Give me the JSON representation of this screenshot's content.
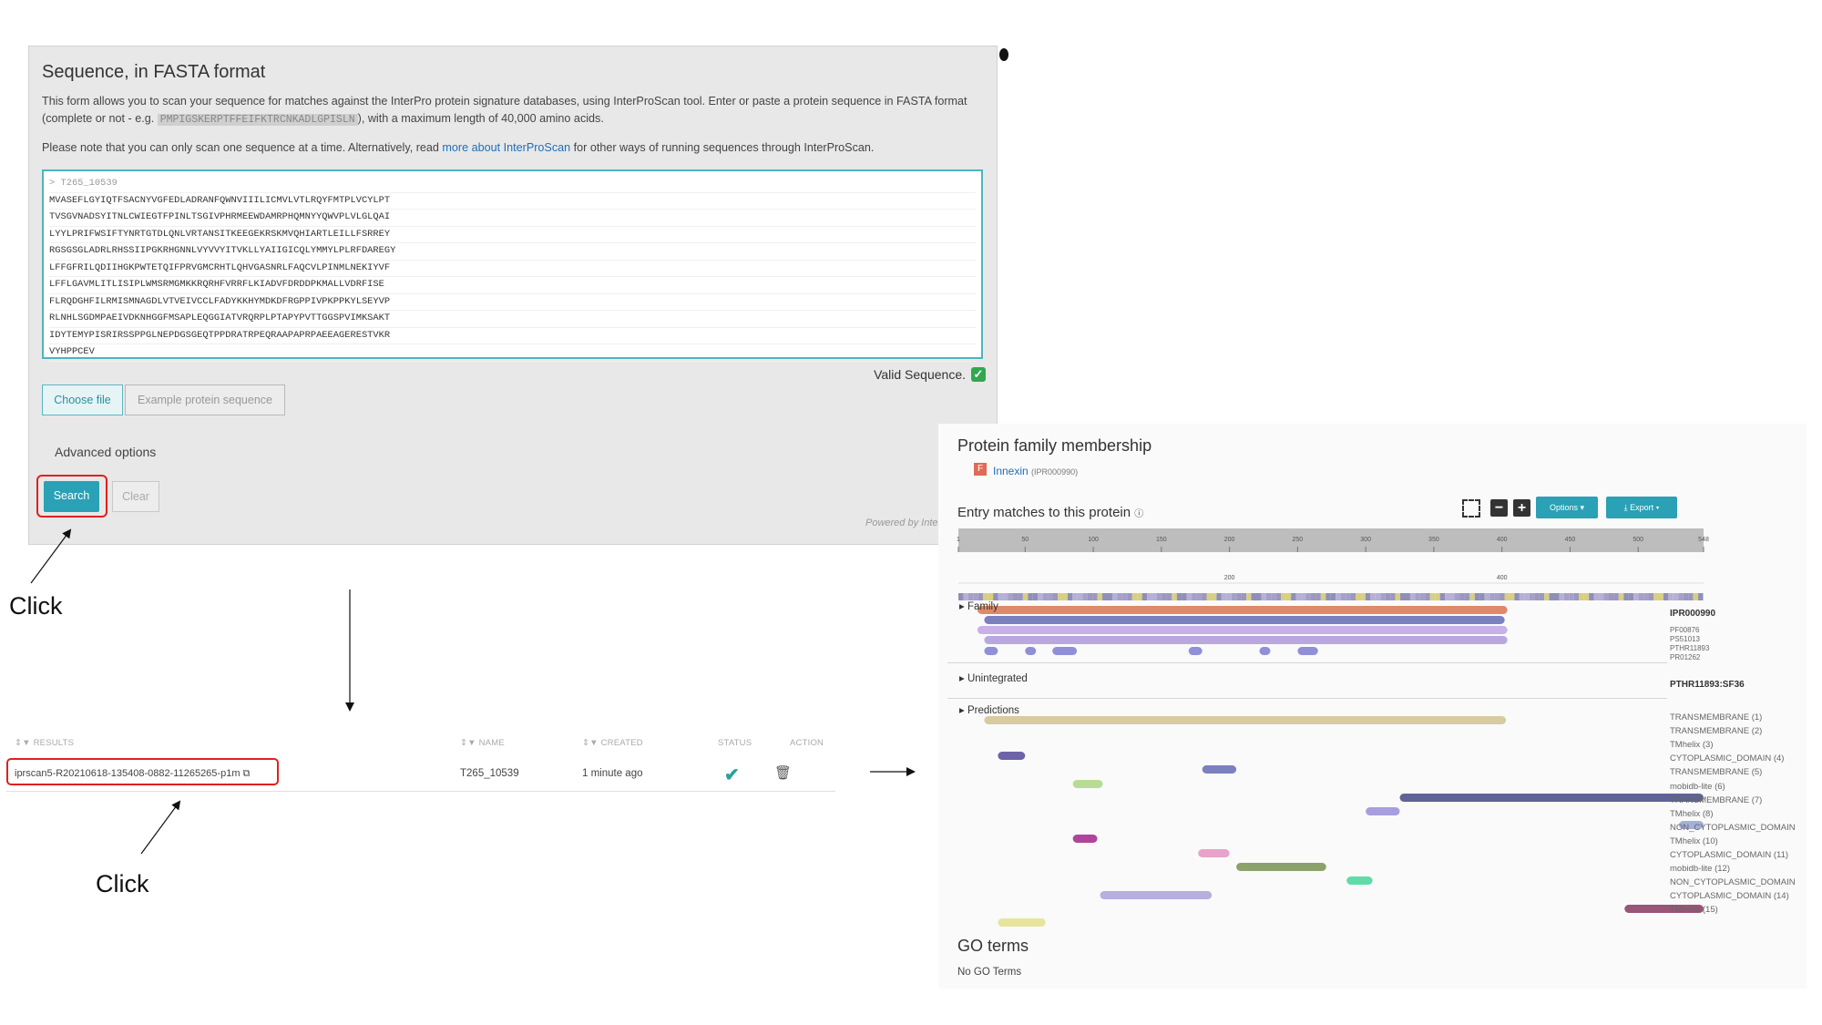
{
  "form": {
    "title": "Sequence, in FASTA format",
    "description_1": "This form allows you to scan your sequence for matches against the InterPro protein signature databases, using InterProScan tool. Enter or paste a protein sequence in FASTA format (complete or not - e.g. ",
    "example_snippet": "PMPIGSKERPTFFEIFKTRCNKADLGPISLN",
    "description_2": "), with a maximum length of 40,000 amino acids.",
    "note_1": "Please note that you can only scan one sequence at a time. Alternatively, read ",
    "note_link": "more about InterProScan",
    "note_2": " for other ways of running sequences through InterProScan.",
    "sequence_lines": [
      "> T265_10539",
      "MVASEFLGYIQTFSACNYVGFEDLADRANFQWNVIIILICMVLVTLRQYFMTPLVCYLPT",
      "TVSGVNADSYITNLCWIEGTFPINLTSGIVPHRMEEWDAMRPHQMNYYQWVPLVLGLQAI",
      "LYYLPRIFWSIFTYNRTGTDLQNLVRTANSITKEEGEKRSKMVQHIARTLEILLFSRREY",
      "RGSGSGLADRLRHSSIIPGKRHGNNLVYVVYITVKLLYAIIGICQLYMMYLPLRFDAREGY",
      "LFFGFRILQDIIHGKPWTETQIFPRVGMCRHTLQHVGASNRLFAQCVLPINMLNEKIYVF",
      "LFFLGAVMLITLISIPLWMSRMGMKKRQRHFVRRFLKIADVFDRDDPKMALLVDRFISE",
      "FLRQDGHFILRMISMNAGDLVTVEIVCCLFADYKKHYMDKDFRGPPIVPKPPKYLSEYVP",
      "RLNHLSGDMPAEIVDKNHGGFMSAPLEQGGIATVRQRPLPTAPYPVTTGGSPVIMKSAKT",
      "IDYTEMYPISRIRSSPPGLNEPDGSGEQTPPDRATRPEQRAAPAPRPAEEAGERESTVKR",
      "VYHPPCEV"
    ],
    "valid_label": "Valid Sequence.",
    "valid_icon": "check-mark-icon",
    "choose_file": "Choose file",
    "example_button": "Example protein sequence",
    "advanced": "Advanced options",
    "search": "Search",
    "clear": "Clear",
    "powered": "Powered by Inter"
  },
  "annotations": {
    "click_1": "Click",
    "click_2": "Click"
  },
  "results_table": {
    "headers": {
      "results": "RESULTS",
      "name": "NAME",
      "created": "CREATED",
      "status": "STATUS",
      "action": "ACTION"
    },
    "row": {
      "id": "iprscan5-R20210618-135408-0882-11265265-p1m",
      "name": "T265_10539",
      "created": "1 minute ago",
      "status_icon": "check-icon",
      "action_icon": "trash-icon"
    }
  },
  "protein_result": {
    "family_title": "Protein family membership",
    "family_badge": "F",
    "family_name": "Innexin",
    "family_acc": "(IPR000990)",
    "entry_title": "Entry matches to this protein",
    "options": "Options",
    "export": "Export",
    "ruler_ticks": [
      "1",
      "50",
      "100",
      "150",
      "200",
      "250",
      "300",
      "350",
      "400",
      "450",
      "500",
      "548"
    ],
    "minimap_ticks": [
      "200",
      "400"
    ],
    "categories": {
      "family": "Family",
      "unintegrated": "Unintegrated",
      "predictions": "Predictions"
    },
    "family_tracks": [
      "IPR000990",
      "PF00876",
      "PS51013",
      "PTHR11893",
      "PR01262"
    ],
    "unintegrated_tracks": [
      "PTHR11893:SF36"
    ],
    "prediction_tracks": [
      "TRANSMEMBRANE (1)",
      "TRANSMEMBRANE (2)",
      "TMhelix (3)",
      "CYTOPLASMIC_DOMAIN (4)",
      "TRANSMEMBRANE (5)",
      "mobidb-lite (6)",
      "TRANSMEMBRANE (7)",
      "TMhelix (8)",
      "NON_CYTOPLASMIC_DOMAIN",
      "TMhelix (10)",
      "CYTOPLASMIC_DOMAIN (11)",
      "mobidb-lite (12)",
      "NON_CYTOPLASMIC_DOMAIN",
      "CYTOPLASMIC_DOMAIN (14)",
      "TMhelix (15)"
    ],
    "go_title": "GO terms",
    "go_text": "No GO Terms"
  }
}
